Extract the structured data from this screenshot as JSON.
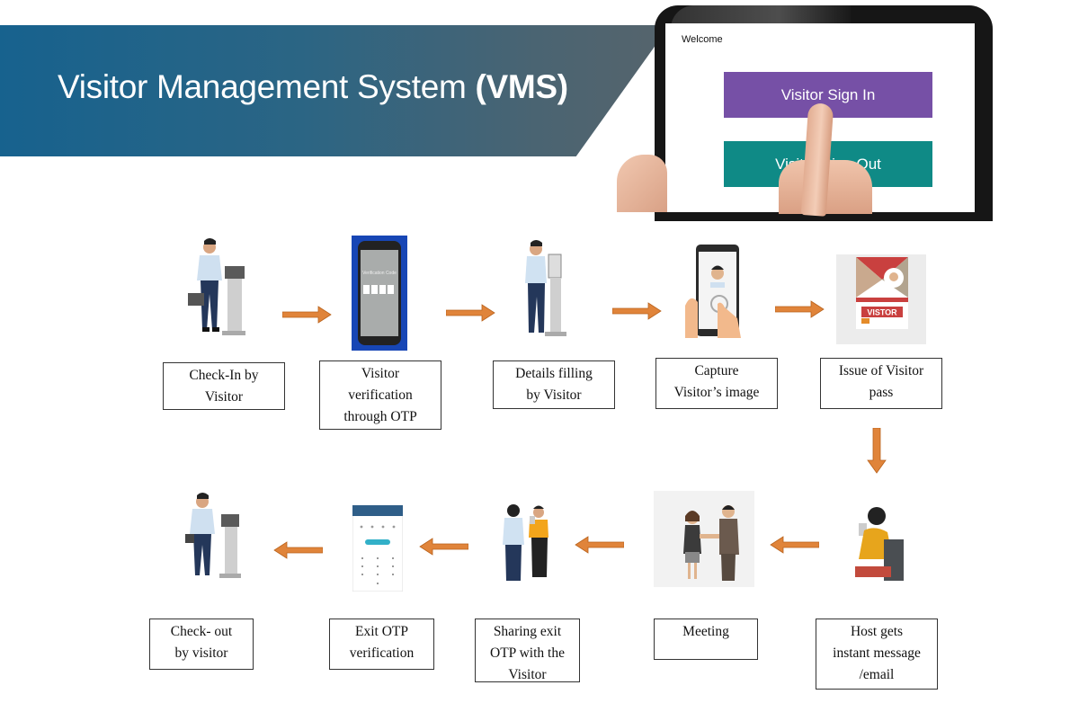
{
  "banner": {
    "title_main": "Visitor Management System ",
    "title_bold": "(VMS)",
    "gradient_start": "#17628e",
    "gradient_end": "#56646c"
  },
  "tablet": {
    "welcome": "Welcome",
    "sign_in_label": "Visitor Sign In",
    "sign_out_label": "Visitor Sign Out",
    "sign_in_color": "#7650a6",
    "sign_out_color": "#0f8a86"
  },
  "flow": {
    "arrow_color": "#e0843a",
    "steps": [
      {
        "id": 1,
        "label": "Check-In by\nVisitor",
        "icon": "visitor-at-kiosk-icon"
      },
      {
        "id": 2,
        "label": "Visitor\nverification\nthrough OTP",
        "icon": "otp-phone-icon",
        "phone_text": "Verification Code"
      },
      {
        "id": 3,
        "label": "Details  filling\nby Visitor",
        "icon": "kiosk-form-icon"
      },
      {
        "id": 4,
        "label": "Capture\nVisitor’s image",
        "icon": "phone-face-capture-icon"
      },
      {
        "id": 5,
        "label": "Issue of Visitor\npass",
        "icon": "visitor-pass-icon",
        "pass_text": "VISTOR"
      },
      {
        "id": 6,
        "label": "Host gets\ninstant message\n/email",
        "icon": "host-phone-icon"
      },
      {
        "id": 7,
        "label": "Meeting",
        "icon": "handshake-icon"
      },
      {
        "id": 8,
        "label": "Sharing exit\nOTP with  the\nVisitor",
        "icon": "share-otp-icon"
      },
      {
        "id": 9,
        "label": "Exit  OTP\nverification",
        "icon": "exit-otp-screen-icon"
      },
      {
        "id": 10,
        "label": "Check- out\nby visitor",
        "icon": "visitor-checkout-icon"
      }
    ]
  }
}
